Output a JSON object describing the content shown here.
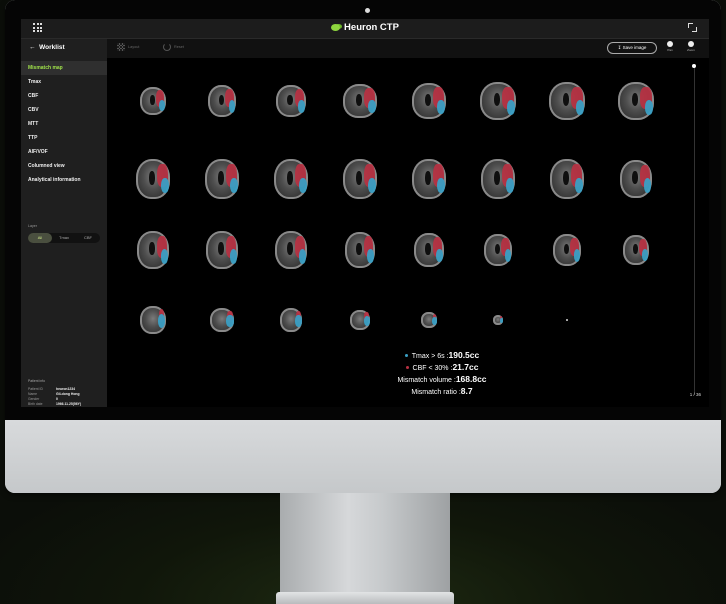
{
  "app": {
    "title": "Heuron CTP",
    "accent": "#8fd63f"
  },
  "sidebar": {
    "back_label": "Worklist",
    "items": [
      {
        "label": "Mismatch map",
        "active": true
      },
      {
        "label": "Tmax"
      },
      {
        "label": "CBF"
      },
      {
        "label": "CBV"
      },
      {
        "label": "MTT"
      },
      {
        "label": "TTP"
      },
      {
        "label": "AIF/VOF"
      },
      {
        "label": "Columned view"
      },
      {
        "label": "Analytical information"
      }
    ],
    "layer": {
      "label": "Layer",
      "options": [
        "All",
        "Tmax",
        "CBF"
      ],
      "selected": "All"
    },
    "patient": {
      "title": "Patient info",
      "rows": [
        {
          "k": "Patient ID",
          "v": "heuron1234"
        },
        {
          "k": "Name",
          "v": "Gil-dong Hong"
        },
        {
          "k": "Gender",
          "v": "0"
        },
        {
          "k": "Birth date",
          "v": "1966.11.25(56Y)"
        },
        {
          "k": "Acquisition date",
          "v": "2023.02.21 15:35"
        }
      ]
    }
  },
  "toolbar": {
    "layout_label": "Layout",
    "reset_label": "Reset",
    "save_label": "Save image",
    "pan_label": "Pan",
    "zoom_label": "Zoom"
  },
  "viewer": {
    "slice_counter": "1 / 36",
    "colors": {
      "tmax": "#3a9fc4",
      "cbf": "#b83142"
    },
    "stats": {
      "tmax_label": "Tmax > 6s :",
      "tmax_value": "190.5cc",
      "cbf_label": "CBF < 30% :",
      "cbf_value": "21.7cc",
      "volume_label": "Mismatch volume :",
      "volume_value": "168.8cc",
      "ratio_label": "Mismatch ratio :",
      "ratio_value": "8.7"
    }
  }
}
